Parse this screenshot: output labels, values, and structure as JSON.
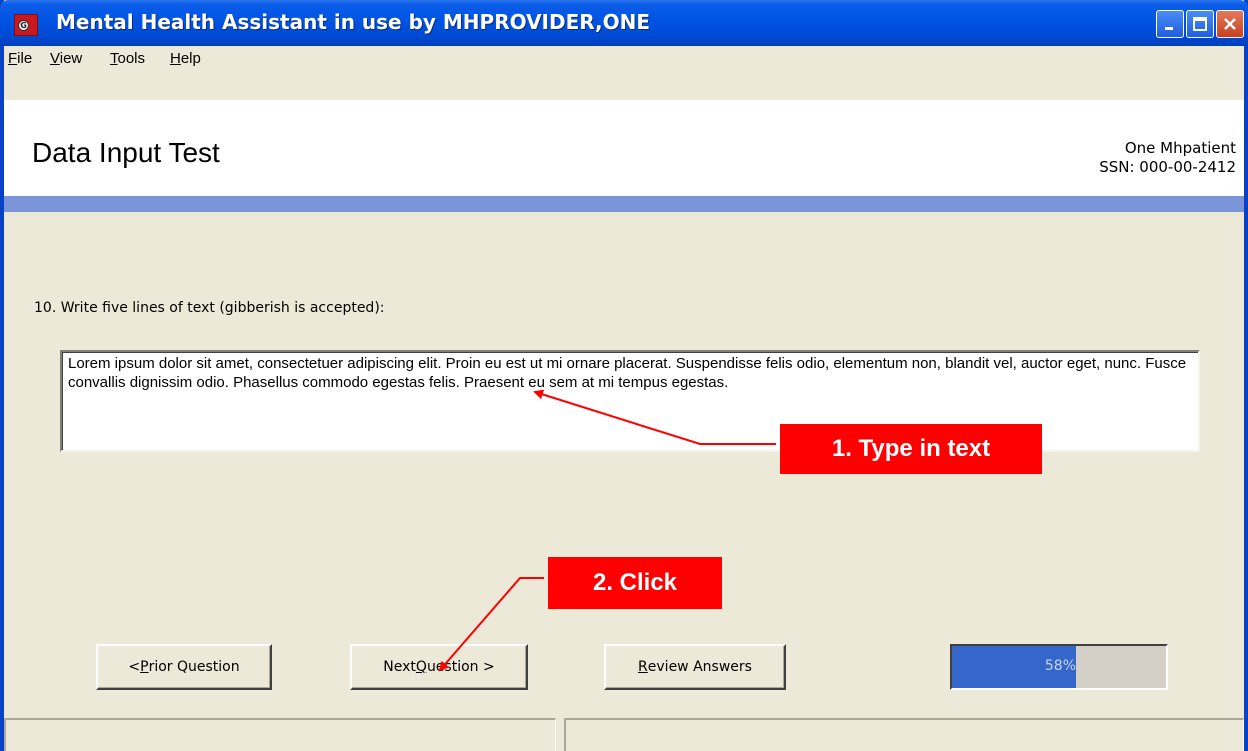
{
  "window": {
    "title": "Mental Health Assistant in use by MHPROVIDER,ONE"
  },
  "menu": {
    "items": [
      {
        "pre": "",
        "key": "F",
        "post": "ile"
      },
      {
        "pre": "",
        "key": "V",
        "post": "iew"
      },
      {
        "pre": "",
        "key": "T",
        "post": "ools"
      },
      {
        "pre": "",
        "key": "H",
        "post": "elp"
      }
    ]
  },
  "header": {
    "title": "Data Input Test",
    "patient_name": "One Mhpatient",
    "patient_ssn": "SSN: 000-00-2412"
  },
  "question": {
    "text": "10. Write five lines of text (gibberish is accepted):",
    "answer": "Lorem ipsum dolor sit amet, consectetuer adipiscing elit. Proin eu est ut mi ornare placerat. Suspendisse felis odio, elementum non, blandit vel, auctor eget, nunc. Fusce convallis dignissim odio. Phasellus commodo egestas felis. Praesent eu sem at mi tempus egestas."
  },
  "buttons": {
    "prior": {
      "pre": "< ",
      "key": "P",
      "post": "rior Question"
    },
    "next": {
      "pre": "Next ",
      "key": "Q",
      "post": "uestion >"
    },
    "review": {
      "pre": "",
      "key": "R",
      "post": "eview Answers"
    }
  },
  "progress": {
    "value": 58,
    "label": "58%"
  },
  "callouts": {
    "step1": "1. Type in text",
    "step2": "2. Click"
  },
  "colors": {
    "callout": "#ff0000",
    "progress_fill": "#3566c9",
    "header_band": "#7b95d8"
  }
}
